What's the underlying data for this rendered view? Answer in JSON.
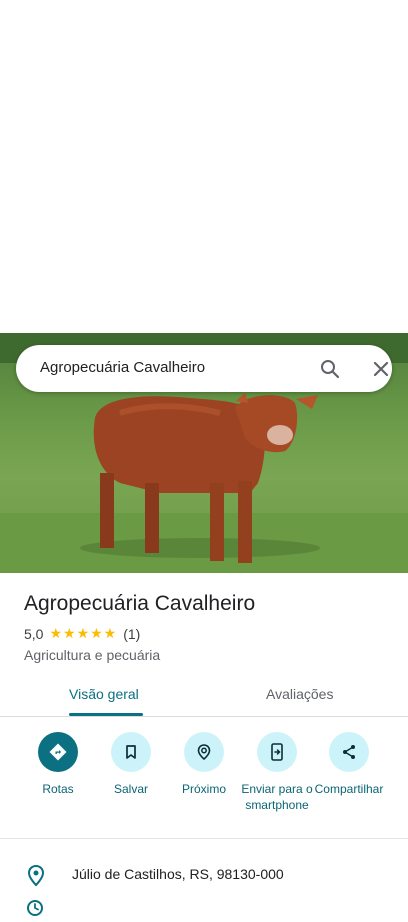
{
  "search": {
    "query": "Agropecuária Cavalheiro"
  },
  "place": {
    "title": "Agropecuária Cavalheiro",
    "rating_value": "5,0",
    "rating_stars": 5,
    "stars_text": "★★★★★",
    "review_count": "(1)",
    "category": "Agricultura e pecuária"
  },
  "tabs": [
    {
      "label": "Visão geral",
      "active": true
    },
    {
      "label": "Avaliações",
      "active": false
    }
  ],
  "actions": [
    {
      "label": "Rotas",
      "icon": "directions-icon"
    },
    {
      "label": "Salvar",
      "icon": "bookmark-icon"
    },
    {
      "label": "Próximo",
      "icon": "nearby-icon"
    },
    {
      "label": "Enviar para o smartphone",
      "icon": "send-to-phone-icon"
    },
    {
      "label": "Compartilhar",
      "icon": "share-icon"
    }
  ],
  "details": {
    "address": "Júlio de Castilhos, RS, 98130-000"
  },
  "colors": {
    "accent": "#0b7081",
    "action_bg": "#cdf3fa",
    "star": "#fbbc04"
  }
}
